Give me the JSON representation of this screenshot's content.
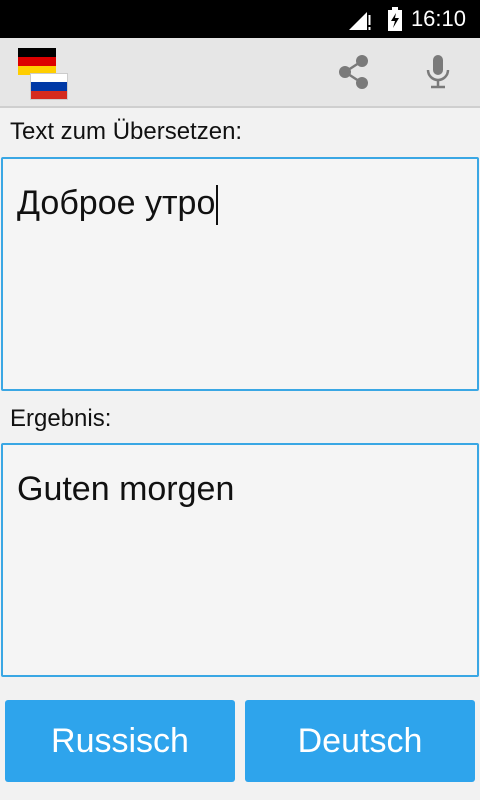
{
  "status_bar": {
    "time": "16:10",
    "icons": [
      "signal-alert-icon",
      "battery-charging-icon"
    ]
  },
  "app_bar": {
    "flags": [
      "german-flag-icon",
      "russian-flag-icon"
    ],
    "actions": [
      "share-icon",
      "microphone-icon"
    ],
    "colors": {
      "flag_de": [
        "#000000",
        "#dd0000",
        "#ffce00"
      ],
      "flag_ru": [
        "#ffffff",
        "#0039a6",
        "#d52b1e"
      ]
    }
  },
  "input": {
    "label": "Text zum Übersetzen:",
    "value": "Доброе утро"
  },
  "output": {
    "label": "Ergebnis:",
    "value": "Guten morgen"
  },
  "buttons": {
    "source_lang": "Russisch",
    "target_lang": "Deutsch"
  },
  "colors": {
    "accent": "#2ea4ec",
    "border": "#3aa7e4"
  }
}
